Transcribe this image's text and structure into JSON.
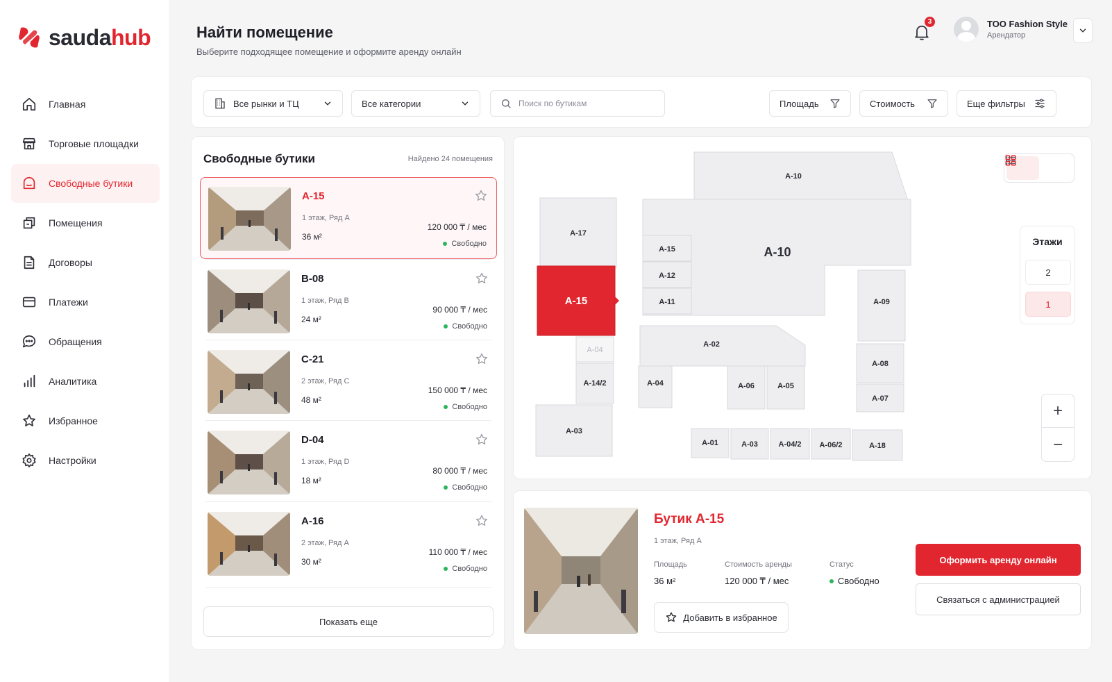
{
  "brand": {
    "name_part1": "sauda",
    "name_part2": "hub",
    "accent": "#e1262f"
  },
  "sidebar": {
    "items": [
      {
        "label": "Главная",
        "icon": "home-icon",
        "active": false
      },
      {
        "label": "Торговые площадки",
        "icon": "store-icon",
        "active": false
      },
      {
        "label": "Свободные бутики",
        "icon": "boutique-icon",
        "active": true
      },
      {
        "label": "Помещения",
        "icon": "rooms-icon",
        "active": false
      },
      {
        "label": "Договоры",
        "icon": "document-icon",
        "active": false
      },
      {
        "label": "Платежи",
        "icon": "card-icon",
        "active": false
      },
      {
        "label": "Обращения",
        "icon": "chat-icon",
        "active": false
      },
      {
        "label": "Аналитика",
        "icon": "analytics-icon",
        "active": false
      },
      {
        "label": "Избранное",
        "icon": "star-icon",
        "active": false
      },
      {
        "label": "Настройки",
        "icon": "settings-icon",
        "active": false
      }
    ]
  },
  "header": {
    "title": "Найти помещение",
    "subtitle": "Выберите подходящее помещение и оформите аренду онлайн",
    "notifications": "3",
    "user_name": "ТОО Fashion Style",
    "user_role": "Арендатор"
  },
  "filters": {
    "markets": "Все рынки и ТЦ",
    "categories": "Все категории",
    "search_placeholder": "Поиск по бутикам",
    "area": "Площадь",
    "cost": "Стоимость",
    "more": "Еще фильтры"
  },
  "list": {
    "title": "Свободные бутики",
    "count": "Найдено 24 помещения",
    "show_more": "Показать еще",
    "items": [
      {
        "code": "A-15",
        "location": "1 этаж, Ряд А",
        "area": "36 м²",
        "price": "120 000 ₸ / мес",
        "status": "Свободно",
        "selected": true
      },
      {
        "code": "B-08",
        "location": "1 этаж, Ряд B",
        "area": "24 м²",
        "price": "90 000 ₸ / мес",
        "status": "Свободно",
        "selected": false
      },
      {
        "code": "C-21",
        "location": "2 этаж, Ряд C",
        "area": "48 м²",
        "price": "150 000 ₸ / мес",
        "status": "Свободно",
        "selected": false
      },
      {
        "code": "D-04",
        "location": "1 этаж, Ряд D",
        "area": "18 м²",
        "price": "80 000 ₸ / мес",
        "status": "Свободно",
        "selected": false
      },
      {
        "code": "A-16",
        "location": "2 этаж, Ряд А",
        "area": "30 м²",
        "price": "110 000 ₸ / мес",
        "status": "Свободно",
        "selected": false
      }
    ]
  },
  "map": {
    "floors_title": "Этажи",
    "floors": [
      "2",
      "1"
    ],
    "active_floor": "1",
    "zoom_in": "+",
    "zoom_out": "−",
    "units": {
      "top_a10": "A-10",
      "a17": "A-17",
      "big_a10": "A-10",
      "a15_small": "A-15",
      "a12": "A-12",
      "a11": "A-11",
      "a15_selected": "A-15",
      "a04_faded": "A-04",
      "a14_2": "A-14/2",
      "a03_left": "A-03",
      "a02": "A-02",
      "a04": "A-04",
      "a06": "A-06",
      "a05": "A-05",
      "a09": "A-09",
      "a08": "A-08",
      "a07": "A-07",
      "a01": "A-01",
      "a03_bottom": "A-03",
      "a04_2": "A-04/2",
      "a06_2": "A-06/2",
      "a18": "A-18"
    }
  },
  "detail": {
    "title": "Бутик А-15",
    "location": "1 этаж, Ряд А",
    "area_label": "Площадь",
    "area_value": "36 м²",
    "cost_label": "Стоимость аренды",
    "cost_value": "120 000 ₸ / мес",
    "status_label": "Статус",
    "status_value": "Свободно",
    "favorite": "Добавить в избранное",
    "rent": "Оформить аренду онлайн",
    "contact": "Связаться с администрацией"
  }
}
